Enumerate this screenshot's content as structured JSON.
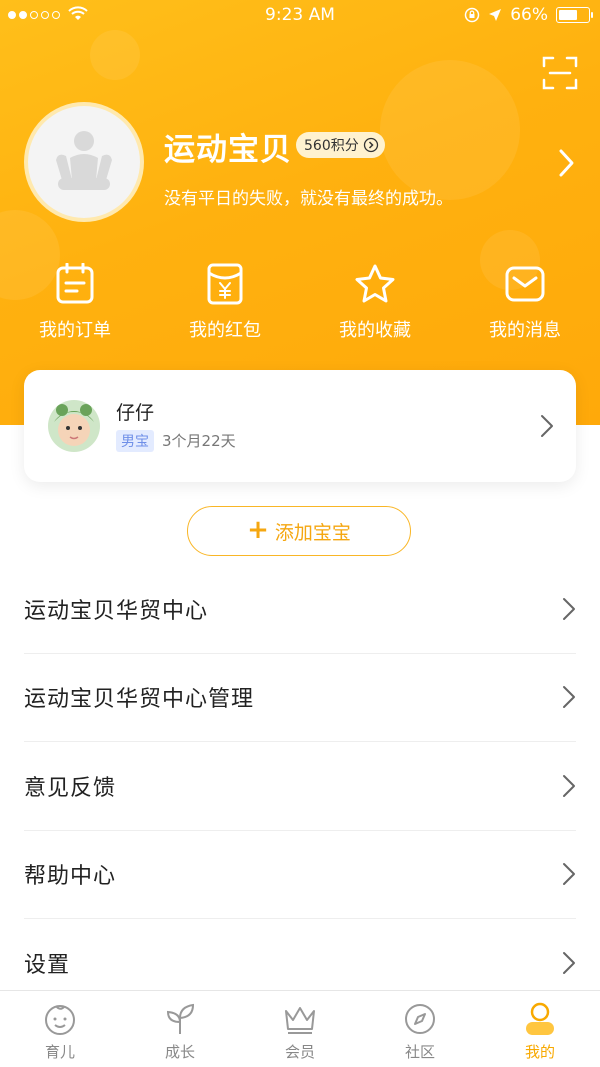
{
  "status_bar": {
    "time": "9:23 AM",
    "battery": "66%"
  },
  "profile": {
    "name": "运动宝贝",
    "points": "560积分",
    "motto": "没有平日的失败，就没有最终的成功。"
  },
  "quick_actions": [
    {
      "label": "我的订单",
      "icon": "order-icon"
    },
    {
      "label": "我的红包",
      "icon": "red-packet-icon"
    },
    {
      "label": "我的收藏",
      "icon": "star-icon"
    },
    {
      "label": "我的消息",
      "icon": "message-icon"
    }
  ],
  "baby": {
    "name": "仔仔",
    "gender": "男宝",
    "age": "3个月22天"
  },
  "add_baby_label": "添加宝宝",
  "menu": [
    {
      "label": "运动宝贝华贸中心"
    },
    {
      "label": "运动宝贝华贸中心管理"
    },
    {
      "label": "意见反馈"
    },
    {
      "label": "帮助中心"
    },
    {
      "label": "设置"
    }
  ],
  "tabs": [
    {
      "label": "育儿",
      "icon": "baby-face-icon"
    },
    {
      "label": "成长",
      "icon": "sprout-icon"
    },
    {
      "label": "会员",
      "icon": "crown-icon"
    },
    {
      "label": "社区",
      "icon": "compass-icon"
    },
    {
      "label": "我的",
      "icon": "person-icon",
      "active": true
    }
  ],
  "colors": {
    "accent": "#ffb10f",
    "active_tab": "#f8a900",
    "tag_blue": "#6f8fe8"
  }
}
